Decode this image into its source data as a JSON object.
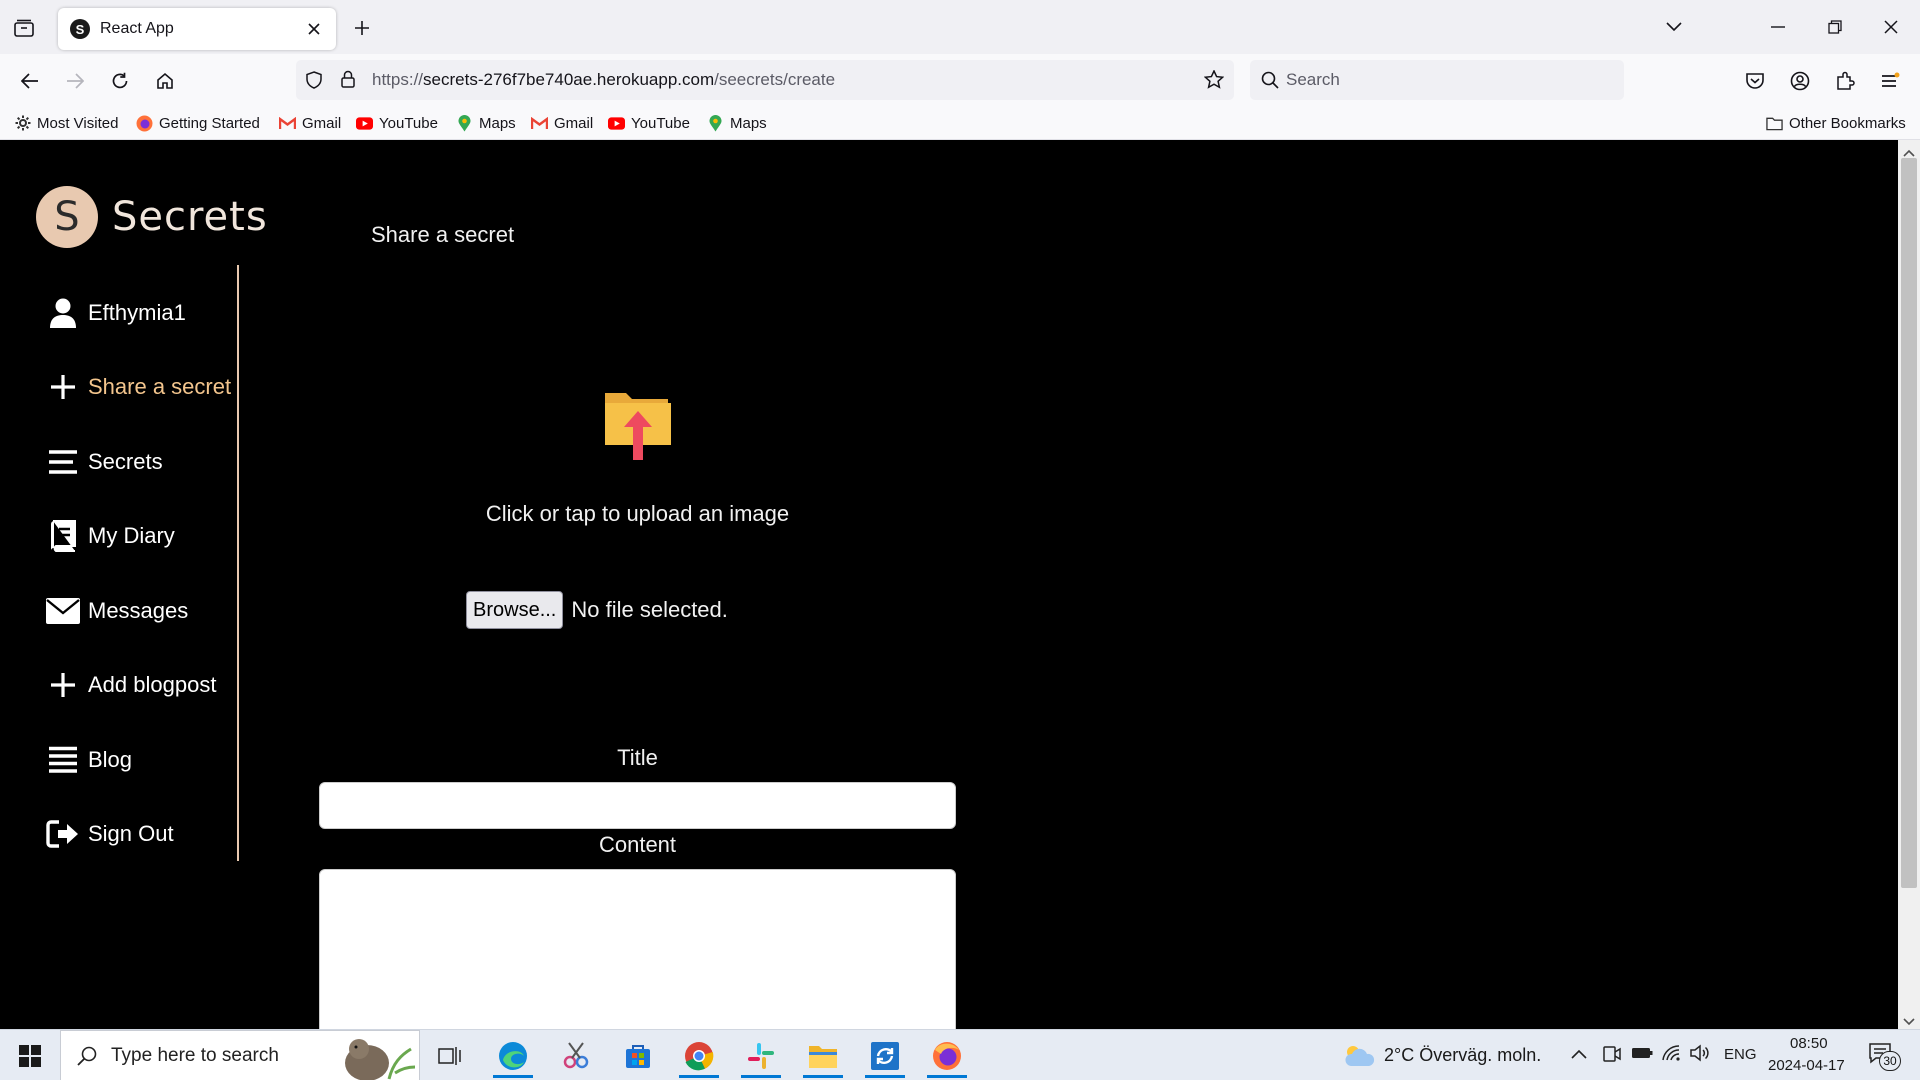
{
  "browser": {
    "tab_title": "React App",
    "tab_favicon_letter": "S",
    "url_prefix": "https://",
    "url_host": "secrets-276f7be740ae.herokuapp.com",
    "url_path": "/seecrets/create",
    "search_placeholder": "Search",
    "bookmarks": [
      {
        "label": "Most Visited",
        "icon": "gear-icon"
      },
      {
        "label": "Getting Started",
        "icon": "firefox-icon"
      },
      {
        "label": "Gmail",
        "icon": "gmail-icon"
      },
      {
        "label": "YouTube",
        "icon": "youtube-icon"
      },
      {
        "label": "Maps",
        "icon": "maps-icon"
      },
      {
        "label": "Gmail",
        "icon": "gmail-icon"
      },
      {
        "label": "YouTube",
        "icon": "youtube-icon"
      },
      {
        "label": "Maps",
        "icon": "maps-icon"
      }
    ],
    "other_bookmarks": "Other Bookmarks"
  },
  "app": {
    "brand_letter": "S",
    "brand_name": "Secrets",
    "sidebar": [
      {
        "label": "Efthymia1",
        "icon": "user-icon"
      },
      {
        "label": "Share a secret",
        "icon": "plus-icon",
        "active": true
      },
      {
        "label": "Secrets",
        "icon": "list-icon"
      },
      {
        "label": "My Diary",
        "icon": "diary-icon"
      },
      {
        "label": "Messages",
        "icon": "envelope-icon"
      },
      {
        "label": "Add blogpost",
        "icon": "plus-icon"
      },
      {
        "label": "Blog",
        "icon": "list-icon"
      },
      {
        "label": "Sign Out",
        "icon": "sign-out-icon"
      }
    ],
    "heading": "Share a secret",
    "upload_text": "Click or tap to upload an image",
    "browse_label": "Browse...",
    "file_status": "No file selected.",
    "title_label": "Title",
    "content_label": "Content",
    "title_value": "",
    "content_value": ""
  },
  "taskbar": {
    "search_placeholder": "Type here to search",
    "weather": "2°C  Överväg. moln.",
    "language": "ENG",
    "time": "08:50",
    "date": "2024-04-17",
    "notifications": "30"
  },
  "colors": {
    "accent": "#f3c58d",
    "brand_circle": "#e8c9b0",
    "page_bg": "#000000"
  }
}
